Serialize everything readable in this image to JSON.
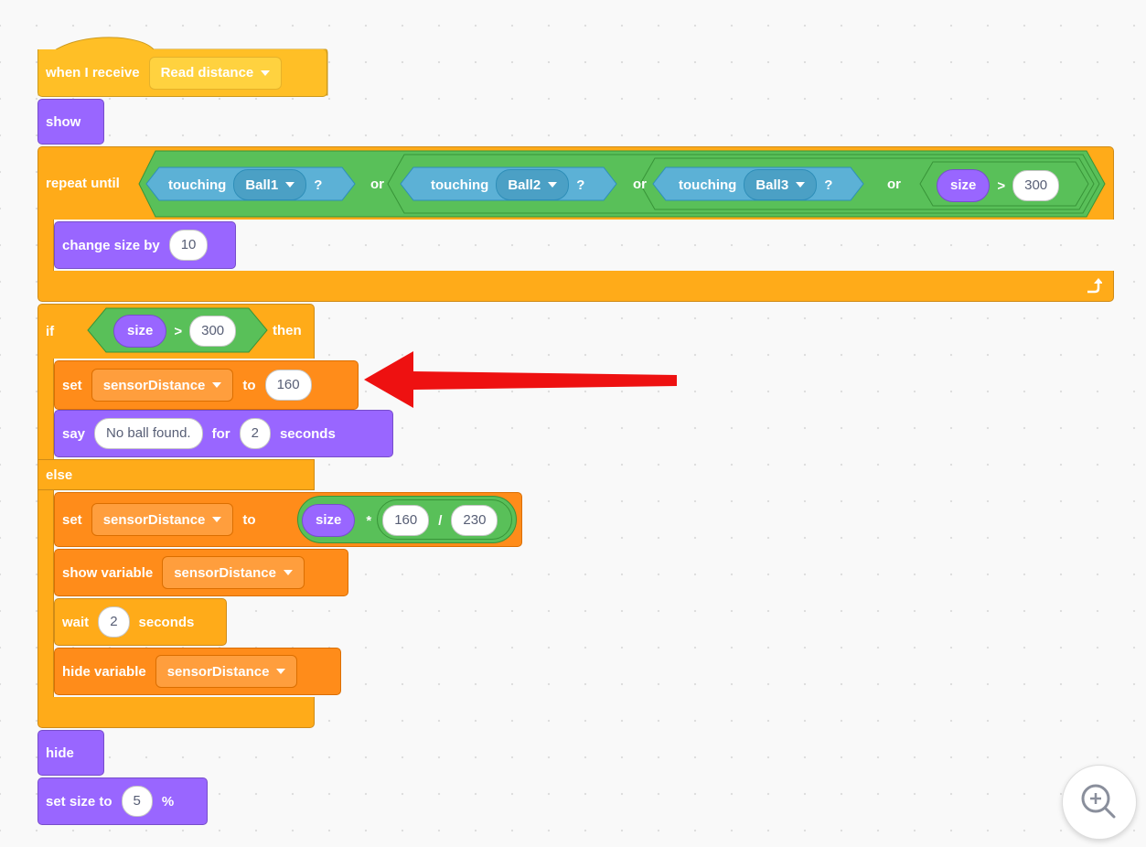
{
  "script": {
    "hat": {
      "label": "when I receive",
      "message": "Read distance"
    },
    "show": {
      "label": "show"
    },
    "repeat": {
      "label": "repeat until",
      "or_label": "or",
      "touching_label": "touching",
      "question": "?",
      "ball1": "Ball1",
      "ball2": "Ball2",
      "ball3": "Ball3",
      "size_reporter": "size",
      "gt": ">",
      "limit": "300"
    },
    "change_size": {
      "label": "change size by",
      "value": "10"
    },
    "if_block": {
      "label": "if",
      "size_reporter": "size",
      "gt": ">",
      "limit": "300",
      "then": "then",
      "else": "else"
    },
    "set1": {
      "label": "set",
      "variable": "sensorDistance",
      "to": "to",
      "value": "160"
    },
    "say": {
      "label": "say",
      "message": "No ball found.",
      "for": "for",
      "seconds_value": "2",
      "seconds": "seconds"
    },
    "set2": {
      "label": "set",
      "variable": "sensorDistance",
      "to": "to",
      "size_reporter": "size",
      "times": "*",
      "num": "160",
      "div": "/",
      "den": "230"
    },
    "show_var": {
      "label": "show variable",
      "variable": "sensorDistance"
    },
    "wait": {
      "label": "wait",
      "value": "2",
      "seconds": "seconds"
    },
    "hide_var": {
      "label": "hide variable",
      "variable": "sensorDistance"
    },
    "hide": {
      "label": "hide"
    },
    "set_size": {
      "label": "set size to",
      "value": "5",
      "percent": "%"
    }
  },
  "icons": [
    "repeat-arrow-icon",
    "dropdown-caret-icon",
    "zoom-in-icon",
    "red-arrow-annotation"
  ],
  "colors": {
    "events": "#ffbf26",
    "looks": "#9966ff",
    "control": "#ffab19",
    "variables": "#ff8c1a",
    "sensing": "#5cb1d6",
    "operators": "#59c059",
    "annotation": "#ee1111"
  }
}
